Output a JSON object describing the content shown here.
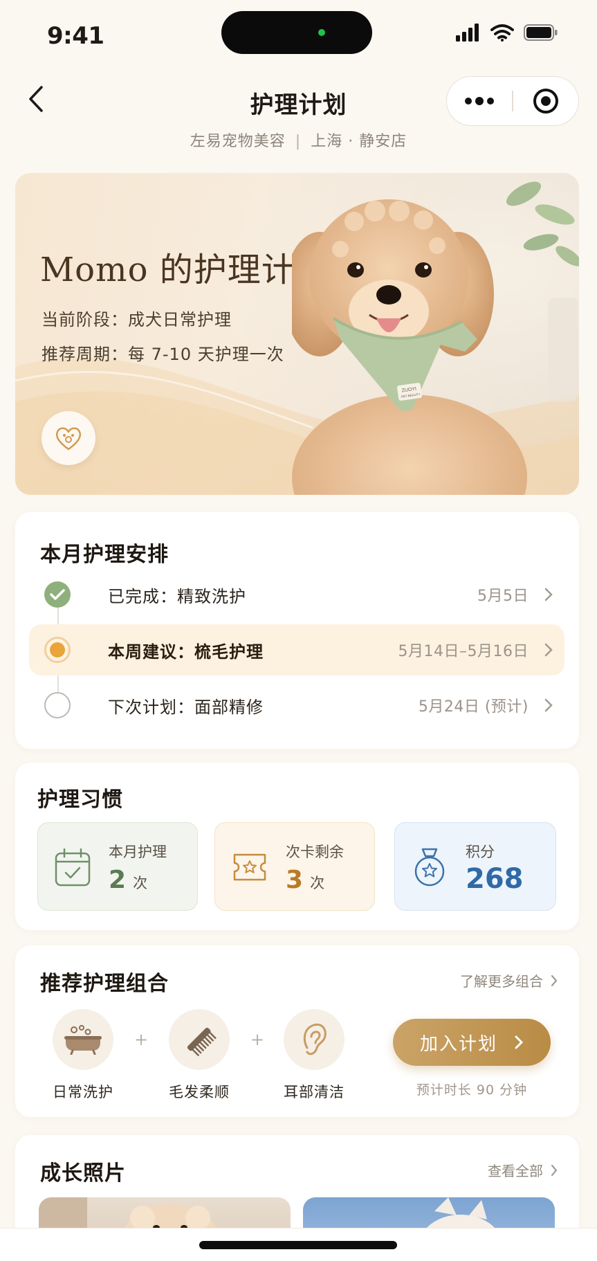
{
  "status_bar": {
    "time": "9:41"
  },
  "nav": {
    "title": "护理计划"
  },
  "store": {
    "name": "左易宠物美容",
    "separator": "|",
    "location": "上海 · 静安店"
  },
  "hero": {
    "title": "Momo 的护理计划",
    "stage": "当前阶段：成犬日常护理",
    "cycle": "推荐周期：每 7-10 天护理一次",
    "bandana_tag_line1": "ZUOYI",
    "bandana_tag_line2": "PET BEAUTY"
  },
  "schedule": {
    "title": "本月护理安排",
    "items": [
      {
        "label": "已完成：精致洗护",
        "date": "5月5日",
        "status": "done"
      },
      {
        "label": "本周建议：梳毛护理",
        "date": "5月14日–5月16日",
        "status": "active"
      },
      {
        "label": "下次计划：面部精修",
        "date": "5月24日 (预计)",
        "status": "upcoming"
      }
    ]
  },
  "habits": {
    "title": "护理习惯",
    "items": [
      {
        "label": "本月护理",
        "value": "2",
        "unit": "次",
        "icon": "calendar-check-icon",
        "color": "#5b7b55"
      },
      {
        "label": "次卡剩余",
        "value": "3",
        "unit": "次",
        "icon": "ticket-star-icon",
        "color": "#b97a28"
      },
      {
        "label": "积分",
        "value": "268",
        "unit": "",
        "icon": "medal-star-icon",
        "color": "#2f6aa6"
      }
    ]
  },
  "combo": {
    "title": "推荐护理组合",
    "more": "了解更多组合",
    "items": [
      {
        "label": "日常洗护",
        "icon": "bathtub-icon"
      },
      {
        "label": "毛发柔顺",
        "icon": "comb-icon"
      },
      {
        "label": "耳部清洁",
        "icon": "ear-icon"
      }
    ],
    "plus": "+",
    "button": "加入计划",
    "duration": "预计时长 90 分钟"
  },
  "photos": {
    "title": "成长照片",
    "more": "查看全部"
  },
  "colors": {
    "accent": "#b98c45",
    "done": "#8fb07c",
    "active": "#e9a43a",
    "background": "#fbf7f1"
  }
}
